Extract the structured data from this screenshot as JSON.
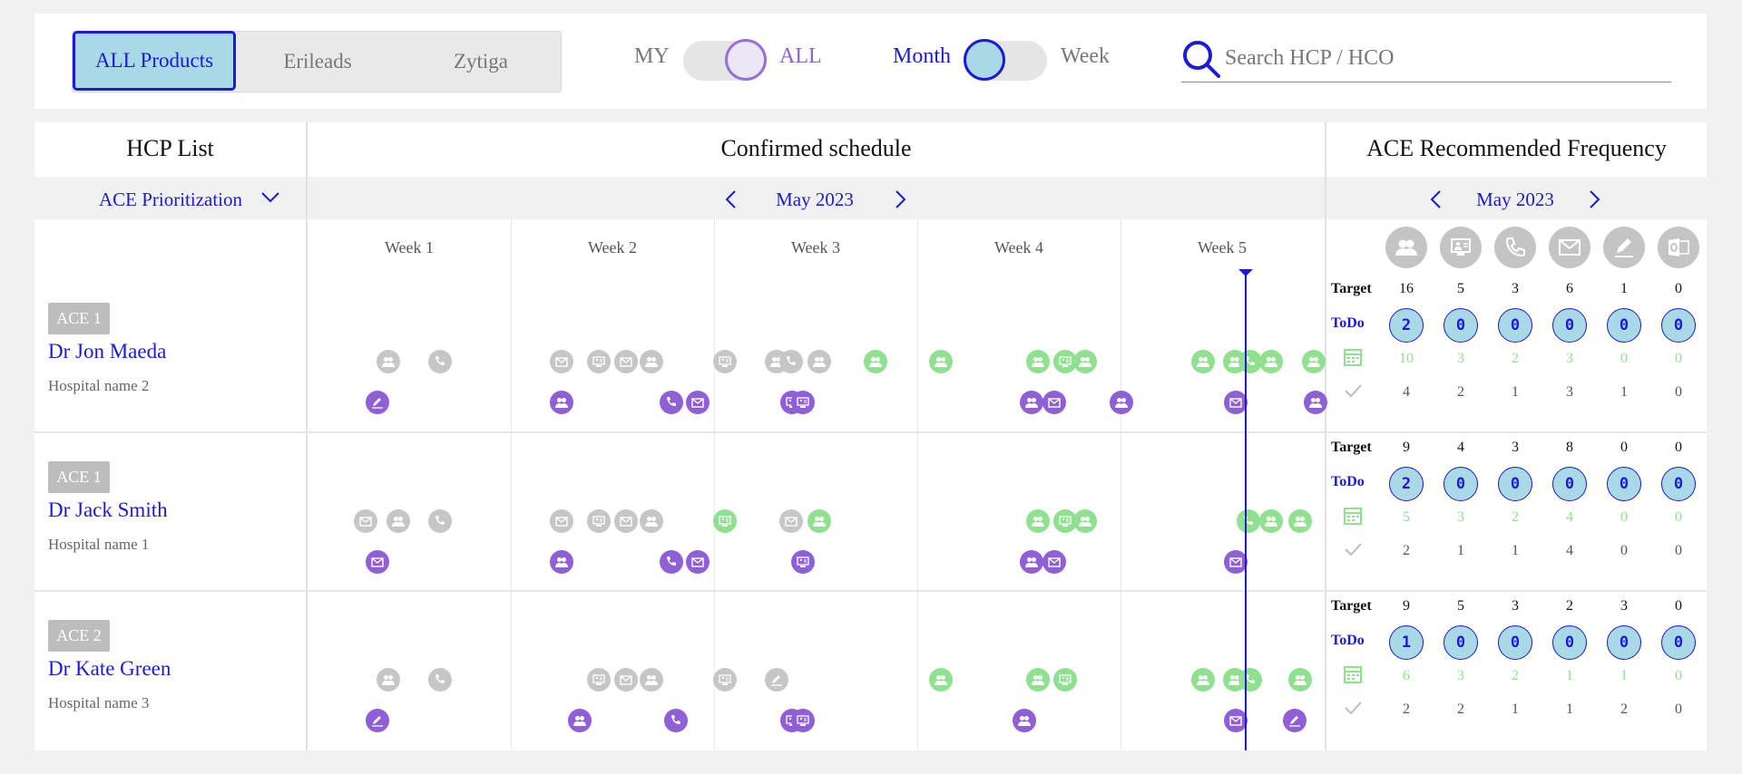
{
  "products": {
    "tabs": [
      "ALL Products",
      "Erileads",
      "Zytiga"
    ],
    "active": 0
  },
  "scope_toggle": {
    "left": "MY",
    "right": "ALL",
    "selected": "ALL"
  },
  "period_toggle": {
    "left": "Month",
    "right": "Week",
    "selected": "Month"
  },
  "search": {
    "placeholder": "Search HCP / HCO"
  },
  "hcp_list": {
    "title": "HCP List",
    "sort_label": "ACE Prioritization"
  },
  "schedule": {
    "title": "Confirmed schedule",
    "month": "May 2023",
    "weeks": [
      "Week 1",
      "Week 2",
      "Week 3",
      "Week 4",
      "Week 5"
    ]
  },
  "ace": {
    "title": "ACE Recommended Frequency",
    "month": "May 2023",
    "channels": [
      "meeting-icon",
      "remote-meeting-icon",
      "phone-icon",
      "email-icon",
      "signature-icon",
      "outlook-icon"
    ],
    "row_labels": {
      "target": "Target",
      "todo": "ToDo"
    }
  },
  "doctors": [
    {
      "badge": "ACE 1",
      "name": "Dr Jon Maeda",
      "hospital": "Hospital name 2",
      "target": [
        "16",
        "5",
        "3",
        "6",
        "1",
        "0"
      ],
      "todo": [
        "2",
        "0",
        "0",
        "0",
        "0",
        "0"
      ],
      "planned": [
        "10",
        "3",
        "2",
        "3",
        "0",
        "0"
      ],
      "done": [
        "4",
        "2",
        "1",
        "3",
        "1",
        "0"
      ]
    },
    {
      "badge": "ACE 1",
      "name": "Dr Jack Smith",
      "hospital": "Hospital name 1",
      "target": [
        "9",
        "4",
        "3",
        "8",
        "0",
        "0"
      ],
      "todo": [
        "2",
        "0",
        "0",
        "0",
        "0",
        "0"
      ],
      "planned": [
        "5",
        "3",
        "2",
        "4",
        "0",
        "0"
      ],
      "done": [
        "2",
        "1",
        "1",
        "4",
        "0",
        "0"
      ]
    },
    {
      "badge": "ACE 2",
      "name": "Dr Kate Green",
      "hospital": "Hospital name 3",
      "target": [
        "9",
        "5",
        "3",
        "2",
        "3",
        "0"
      ],
      "todo": [
        "1",
        "0",
        "0",
        "0",
        "0",
        "0"
      ],
      "planned": [
        "6",
        "3",
        "2",
        "1",
        "1",
        "0"
      ],
      "done": [
        "2",
        "2",
        "1",
        "1",
        "2",
        "0"
      ]
    }
  ],
  "colors": {
    "accent": "#1a1ad8",
    "past": "#c6c6c6",
    "planned": "#8fe08f",
    "confirmed": "#8f5fd8",
    "todo_fill": "#a9d8e6"
  }
}
